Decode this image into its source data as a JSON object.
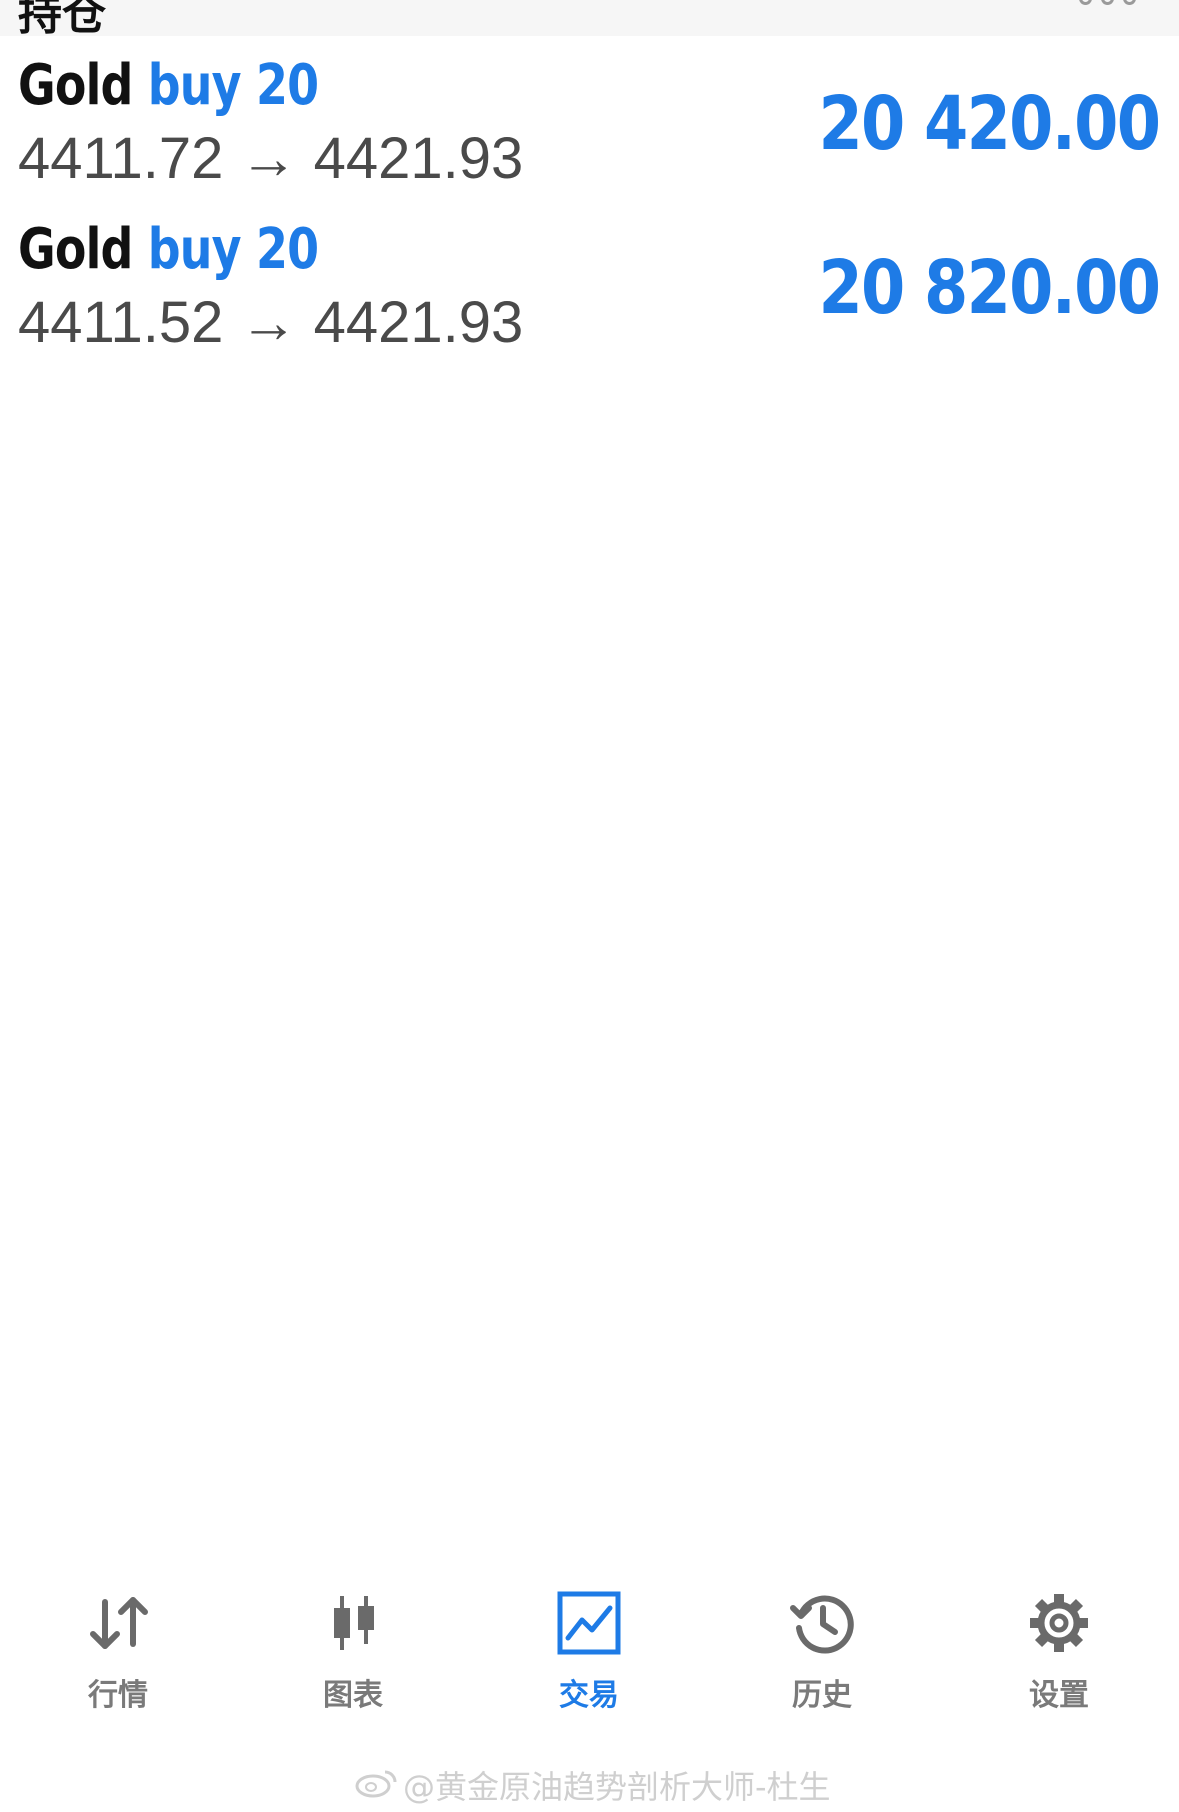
{
  "header": {
    "title": "持仓"
  },
  "positions": [
    {
      "symbol": "Gold",
      "side": "buy",
      "volume": "20",
      "open_price": "4411.72",
      "arrow": "→",
      "current_price": "4421.93",
      "profit": "20 420.00"
    },
    {
      "symbol": "Gold",
      "side": "buy",
      "volume": "20",
      "open_price": "4411.52",
      "arrow": "→",
      "current_price": "4421.93",
      "profit": "20 820.00"
    }
  ],
  "tabs": [
    {
      "label": "行情",
      "icon": "quotes-icon",
      "active": false
    },
    {
      "label": "图表",
      "icon": "chart-candles-icon",
      "active": false
    },
    {
      "label": "交易",
      "icon": "trade-icon",
      "active": true
    },
    {
      "label": "历史",
      "icon": "history-icon",
      "active": false
    },
    {
      "label": "设置",
      "icon": "settings-gear-icon",
      "active": false
    }
  ],
  "watermark": {
    "text": "@黄金原油趋势剖析大师-杜生",
    "icon": "weibo-icon"
  },
  "colors": {
    "accent": "#1e7be6",
    "text_dark": "#111111",
    "text_gray": "#4a4a4a",
    "tab_inactive": "#7a7a7a"
  }
}
